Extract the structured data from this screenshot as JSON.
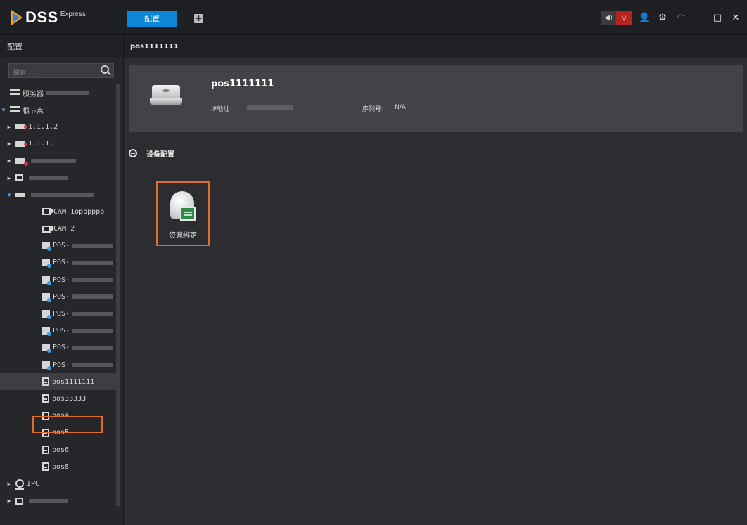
{
  "app": {
    "logo_text": "DSS",
    "logo_sub": "Express",
    "active_tab": "配置",
    "add_tab_glyph": "+",
    "alarm_count": "0"
  },
  "sidebar": {
    "header": "配置",
    "search_placeholder": "搜索......",
    "server_label": "服务器",
    "root_label": "根节点",
    "nodes": [
      {
        "label": "1.1.1.2"
      },
      {
        "label": "1.1.1.1"
      },
      {
        "label": ""
      },
      {
        "label": ""
      },
      {
        "label": ""
      },
      {
        "label": "CAM 1opppppp"
      },
      {
        "label": "CAM 2"
      },
      {
        "label": "POS-"
      },
      {
        "label": "POS-"
      },
      {
        "label": "POS-"
      },
      {
        "label": "POS-"
      },
      {
        "label": "POS-"
      },
      {
        "label": "POS-"
      },
      {
        "label": "POS-"
      },
      {
        "label": "POS-"
      },
      {
        "label": "pos1111111"
      },
      {
        "label": "pos33333"
      },
      {
        "label": "pos4"
      },
      {
        "label": "pos5"
      },
      {
        "label": "pos6"
      },
      {
        "label": "pos8"
      },
      {
        "label": "IPC"
      },
      {
        "label": ""
      }
    ],
    "selected": "pos1111111"
  },
  "main": {
    "breadcrumb": "pos1111111",
    "device": {
      "name": "pos1111111",
      "ip_label": "IP地址：",
      "sn_label": "序列号：",
      "sn_value": "N/A"
    },
    "section_title": "设备配置",
    "tiles": [
      {
        "label": "资源绑定"
      }
    ]
  },
  "colors": {
    "accent": "#0d86d8",
    "highlight": "#e36a28",
    "alarm": "#b42522"
  }
}
